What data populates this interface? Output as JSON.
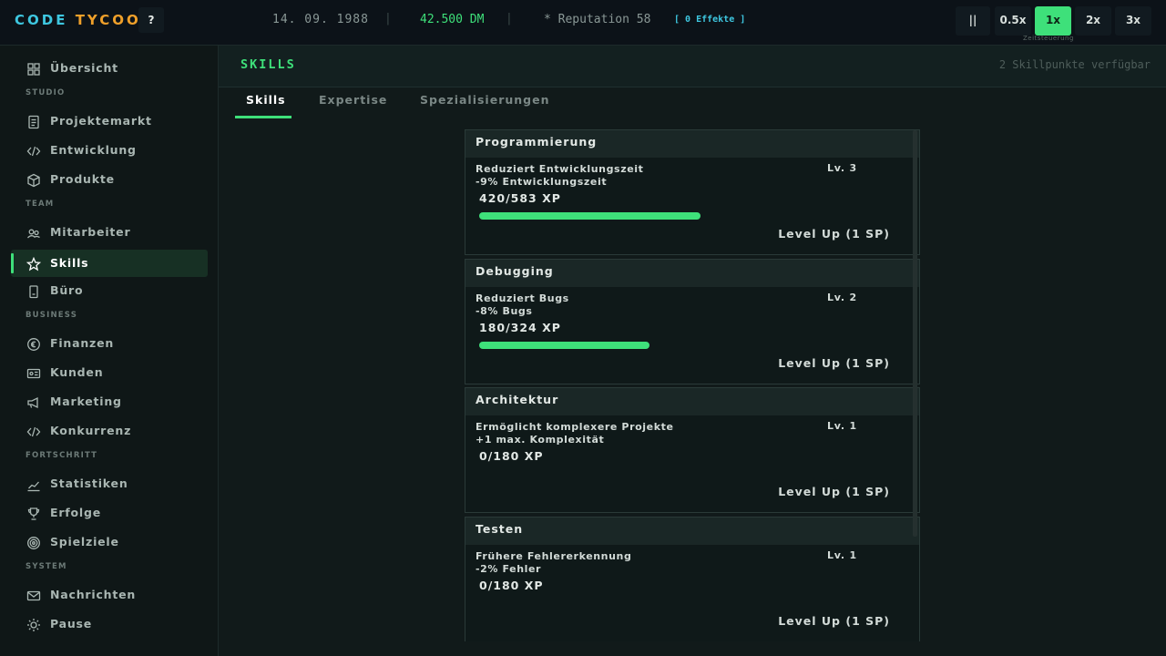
{
  "topbar": {
    "logo_part1": "CODE",
    "logo_part2": "TYCOON",
    "help_label": "?",
    "date": "14. 09. 1988",
    "separator": "|",
    "money": "42.500 DM",
    "reputation": "* Reputation 58",
    "effects": "[ 0 Effekte ]",
    "pause_label": "||",
    "speeds": [
      "0.5x",
      "1x",
      "2x",
      "3x"
    ],
    "active_speed": "1x",
    "speed_caption": "Zeitsteuerung"
  },
  "sidebar": {
    "top_item": {
      "label": "Übersicht",
      "icon": "grid-icon"
    },
    "sections": [
      {
        "label": "STUDIO",
        "items": [
          {
            "label": "Projektemarkt",
            "icon": "document-icon"
          },
          {
            "label": "Entwicklung",
            "icon": "code-icon"
          },
          {
            "label": "Produkte",
            "icon": "box-icon"
          }
        ]
      },
      {
        "label": "TEAM",
        "items": [
          {
            "label": "Mitarbeiter",
            "icon": "people-icon"
          },
          {
            "label": "Skills",
            "icon": "star-icon",
            "active": true
          },
          {
            "label": "Büro",
            "icon": "building-icon"
          }
        ]
      },
      {
        "label": "BUSINESS",
        "items": [
          {
            "label": "Finanzen",
            "icon": "coin-icon"
          },
          {
            "label": "Kunden",
            "icon": "id-card-icon"
          },
          {
            "label": "Marketing",
            "icon": "megaphone-icon"
          },
          {
            "label": "Konkurrenz",
            "icon": "code-icon"
          }
        ]
      },
      {
        "label": "FORTSCHRITT",
        "items": [
          {
            "label": "Statistiken",
            "icon": "chart-icon"
          },
          {
            "label": "Erfolge",
            "icon": "trophy-icon"
          },
          {
            "label": "Spielziele",
            "icon": "target-icon"
          }
        ]
      },
      {
        "label": "SYSTEM",
        "items": [
          {
            "label": "Nachrichten",
            "icon": "mail-icon"
          },
          {
            "label": "Pause",
            "icon": "sun-icon"
          }
        ]
      }
    ]
  },
  "main": {
    "title": "SKILLS",
    "skillpoints": "2 Skillpunkte verfügbar",
    "tabs": [
      "Skills",
      "Expertise",
      "Spezialisierungen"
    ],
    "active_tab": "Skills"
  },
  "skills": [
    {
      "name": "Programmierung",
      "description": "Reduziert Entwicklungszeit",
      "effect": "-9% Entwicklungszeit",
      "level": "Lv. 3",
      "xp": "420/583 XP",
      "progress": 0.72,
      "button": "Level Up (1 SP)"
    },
    {
      "name": "Debugging",
      "description": "Reduziert Bugs",
      "effect": "-8% Bugs",
      "level": "Lv. 2",
      "xp": "180/324 XP",
      "progress": 0.556,
      "button": "Level Up (1 SP)"
    },
    {
      "name": "Architektur",
      "description": "Ermöglicht komplexere Projekte",
      "effect": "+1 max. Komplexität",
      "level": "Lv. 1",
      "xp": "0/180 XP",
      "progress": 0,
      "button": "Level Up (1 SP)"
    },
    {
      "name": "Testen",
      "description": "Frühere Fehlererkennung",
      "effect": "-2% Fehler",
      "level": "Lv. 1",
      "xp": "0/180 XP",
      "progress": 0,
      "button": "Level Up (1 SP)"
    }
  ],
  "colors": {
    "accent": "#3ee07a",
    "logo_blue": "#3ec7e0",
    "logo_orange": "#f0a02a"
  }
}
